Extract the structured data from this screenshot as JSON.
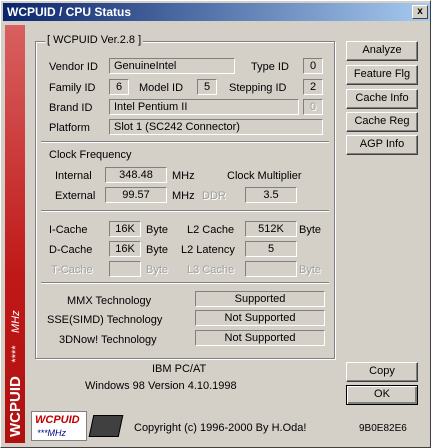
{
  "window": {
    "title": "WCPUID / CPU Status",
    "close_glyph": "x"
  },
  "sidebar": {
    "brand": "WCPUID",
    "stars": "****",
    "sub": "MHz"
  },
  "group": {
    "title": "[ WCPUID Ver.2.8 ]"
  },
  "cpu": {
    "vendor_label": "Vendor ID",
    "vendor": "GenuineIntel",
    "type_label": "Type ID",
    "type": "0",
    "family_label": "Family ID",
    "family": "6",
    "model_label": "Model ID",
    "model": "5",
    "stepping_label": "Stepping ID",
    "stepping": "2",
    "brand_label": "Brand ID",
    "brand": "Intel Pentium II",
    "brand_num": "0",
    "platform_label": "Platform",
    "platform": "Slot 1 (SC242 Connector)"
  },
  "clock": {
    "title": "Clock Frequency",
    "internal_label": "Internal",
    "internal": "348.48",
    "internal_unit": "MHz",
    "multiplier_label": "Clock Multiplier",
    "external_label": "External",
    "external": "99.57",
    "external_unit": "MHz",
    "ddr_label": "DDR",
    "multiplier": "3.5"
  },
  "cache": {
    "icache_label": "I-Cache",
    "icache": "16K",
    "icache_unit": "Byte",
    "l2_label": "L2 Cache",
    "l2": "512K",
    "l2_unit": "Byte",
    "dcache_label": "D-Cache",
    "dcache": "16K",
    "dcache_unit": "Byte",
    "l2lat_label": "L2 Latency",
    "l2lat": "5",
    "tcache_label": "T-Cache",
    "tcache_unit": "Byte",
    "l3_label": "L3 Cache",
    "l3_unit": "Byte"
  },
  "tech": {
    "mmx_label": "MMX Technology",
    "mmx": "Supported",
    "sse_label": "SSE(SIMD) Technology",
    "sse": "Not Supported",
    "now_label": "3DNow! Technology",
    "now": "Not Supported"
  },
  "system": {
    "machine": "IBM PC/AT",
    "os": "Windows 98  Version 4.10.1998"
  },
  "buttons": {
    "analyze": "Analyze",
    "feature": "Feature Flg",
    "cache_info": "Cache Info",
    "cache_reg": "Cache Reg",
    "agp_info": "AGP Info",
    "copy": "Copy",
    "ok": "OK"
  },
  "footer": {
    "copyright": "Copyright (c) 1996-2000  By H.Oda!",
    "code": "9B0E82E6",
    "logo_text": "WCPUID",
    "logo_sub": "***MHz"
  }
}
